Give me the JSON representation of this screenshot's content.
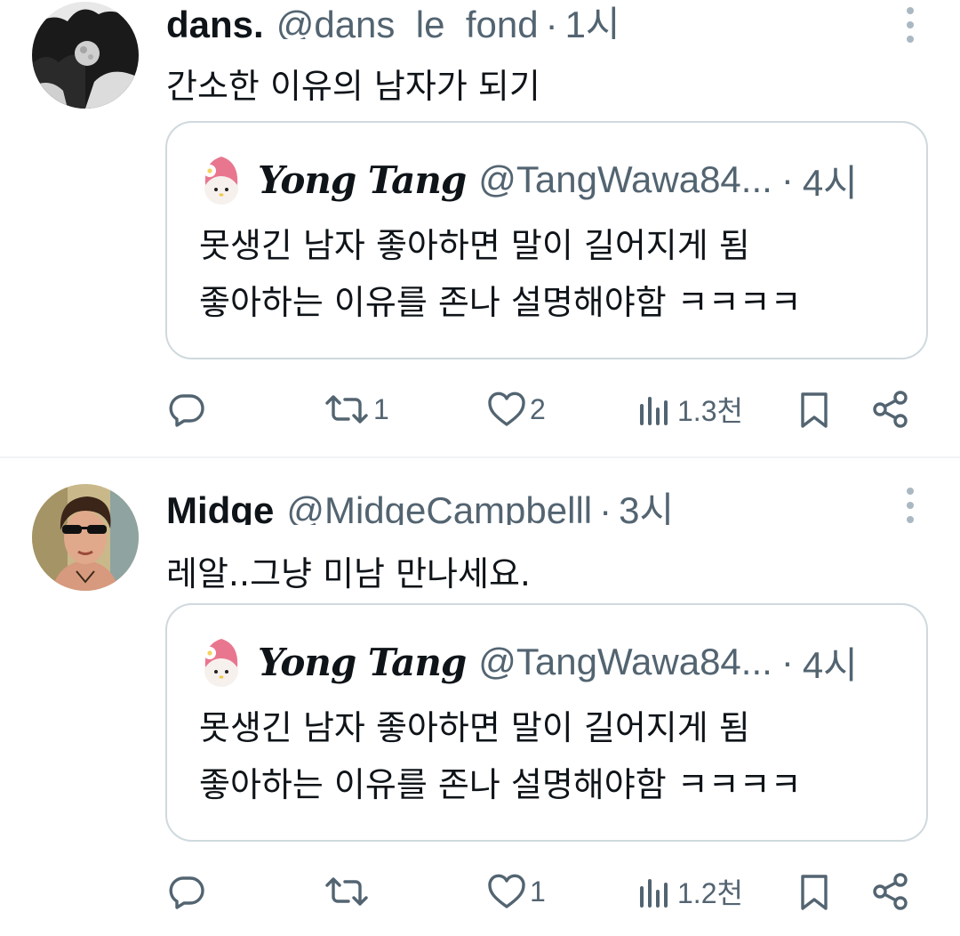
{
  "tweets": [
    {
      "name": "dans.",
      "handle": "@dans_le_fond",
      "dot": "·",
      "time": "1시",
      "text": "간소한 이유의 남자가 되기",
      "quote": {
        "name": "Yong Tang",
        "handle": "@TangWawa84...",
        "dot": "·",
        "time": "4시",
        "line1": "못생긴 남자 좋아하면 말이 길어지게 됨",
        "line2": "좋아하는 이유를 존나 설명해야함 ㅋㅋㅋㅋ"
      },
      "actions": {
        "replies": "",
        "retweets": "1",
        "likes": "2",
        "views": "1.3천"
      }
    },
    {
      "name": "Midge",
      "handle": "@MidgeCampbelll",
      "dot": "·",
      "time": "3시",
      "text": "레알..그냥 미남 만나세요.",
      "quote": {
        "name": "Yong Tang",
        "handle": "@TangWawa84...",
        "dot": "·",
        "time": "4시",
        "line1": "못생긴 남자 좋아하면 말이 길어지게 됨",
        "line2": "좋아하는 이유를 존나 설명해야함 ㅋㅋㅋㅋ"
      },
      "actions": {
        "replies": "",
        "retweets": "",
        "likes": "1",
        "views": "1.2천"
      }
    }
  ],
  "icons": {
    "reply": "reply-icon",
    "retweet": "retweet-icon",
    "like": "heart-icon",
    "views": "views-icon",
    "bookmark": "bookmark-icon",
    "share": "share-icon",
    "more": "more-vertical-icon"
  },
  "colors": {
    "text_primary": "#0f1419",
    "text_secondary": "#536471",
    "border": "#cfd9de",
    "divider": "#eff3f4"
  }
}
